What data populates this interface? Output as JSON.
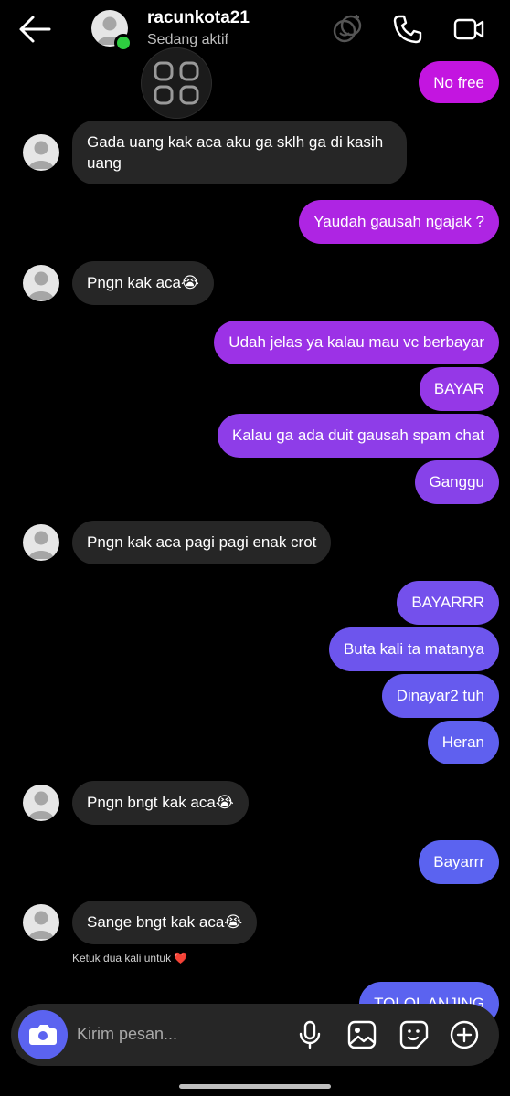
{
  "header": {
    "username": "racunkota21",
    "status": "Sedang aktif",
    "icons": [
      "back-arrow-icon",
      "effects-icon",
      "phone-icon",
      "video-icon",
      "apps-grid-icon"
    ]
  },
  "messages": [
    {
      "side": "out",
      "text": "No free"
    },
    {
      "side": "in",
      "text": "Gada uang kak aca aku ga sklh ga di kasih\nuang"
    },
    {
      "side": "out",
      "text": "Yaudah gausah ngajak ?"
    },
    {
      "side": "in",
      "text": "Pngn kak aca😭"
    },
    {
      "side": "out",
      "text": "Udah jelas ya kalau mau vc berbayar"
    },
    {
      "side": "out",
      "text": "BAYAR"
    },
    {
      "side": "out",
      "text": "Kalau ga ada duit gausah spam chat"
    },
    {
      "side": "out",
      "text": "Ganggu"
    },
    {
      "side": "in",
      "text": "Pngn kak aca pagi pagi enak crot"
    },
    {
      "side": "out",
      "text": "BAYARRR"
    },
    {
      "side": "out",
      "text": "Buta kali ta matanya"
    },
    {
      "side": "out",
      "text": "Dinayar2 tuh"
    },
    {
      "side": "out",
      "text": "Heran"
    },
    {
      "side": "in",
      "text": "Pngn bngt kak aca😭"
    },
    {
      "side": "out",
      "text": "Bayarrr"
    },
    {
      "side": "in",
      "text": "Sange bngt kak aca😭"
    },
    {
      "side": "out",
      "text": "TOLOL ANJING"
    }
  ],
  "hint": {
    "text": "Ketuk dua kali untuk ❤️"
  },
  "composer": {
    "placeholder": "Kirim pesan...",
    "icons": [
      "camera-icon",
      "microphone-icon",
      "gallery-icon",
      "sticker-icon",
      "add-icon"
    ]
  },
  "colors": {
    "background": "#000000",
    "incoming_bubble": "#262626",
    "outgoing_top": "#c414e0",
    "outgoing_bottom": "#5b63f0",
    "online": "#2ecc40"
  }
}
